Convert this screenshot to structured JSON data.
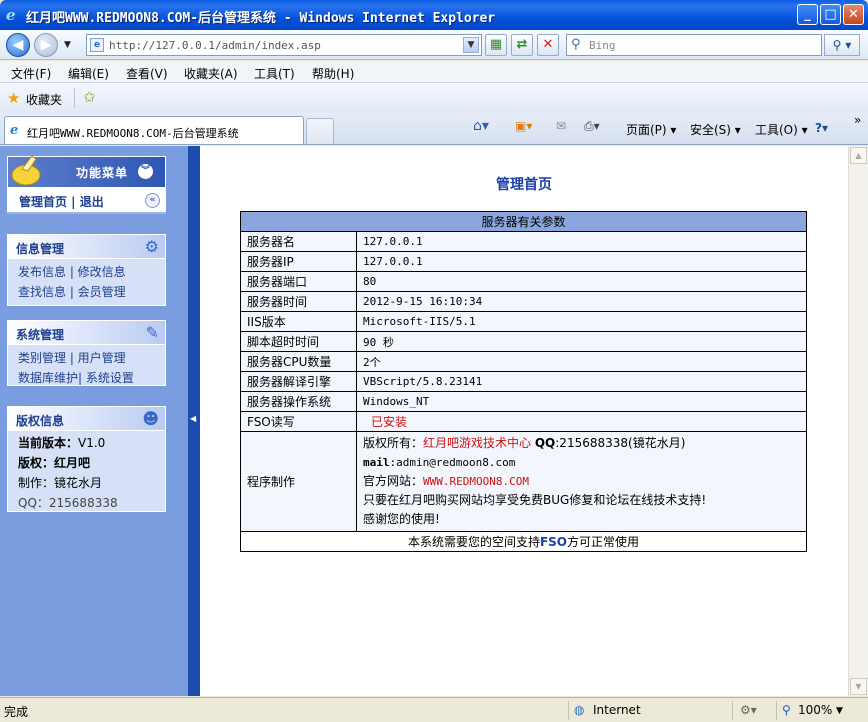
{
  "window": {
    "title": "红月吧WWW.REDMOON8.COM-后台管理系统 - Windows Internet Explorer",
    "minimize": "_",
    "maximize": "□",
    "close": "✕"
  },
  "address_bar": {
    "url": "http://127.0.0.1/admin/index.asp",
    "search_placeholder": "Bing"
  },
  "menu": [
    "文件(F)",
    "编辑(E)",
    "查看(V)",
    "收藏夹(A)",
    "工具(T)",
    "帮助(H)"
  ],
  "favorites": {
    "label": "收藏夹"
  },
  "tab": {
    "title": "红月吧WWW.REDMOON8.COM-后台管理系统"
  },
  "command_bar": {
    "page": "页面(P)",
    "safety": "安全(S)",
    "tools": "工具(O)",
    "more": "»"
  },
  "sidebar": {
    "menu_title": "功能菜单",
    "home": "管理首页 | 退出",
    "sections": [
      {
        "title": "信息管理",
        "rows": [
          "发布信息 | 修改信息",
          "查找信息 | 会员管理"
        ]
      },
      {
        "title": "系统管理",
        "rows": [
          "类别管理 | 用户管理",
          "数据库维护| 系统设置"
        ]
      }
    ],
    "copyright": {
      "title": "版权信息",
      "version_label": "当前版本：",
      "version": "V1.0",
      "owner": "版权：红月吧",
      "maker": "制作：镜花水月",
      "qq": "QQ：215688338"
    }
  },
  "main": {
    "page_title": "管理首页",
    "table_header": "服务器有关参数",
    "rows": [
      {
        "k": "服务器名",
        "v": "127.0.0.1"
      },
      {
        "k": "服务器IP",
        "v": "127.0.0.1"
      },
      {
        "k": "服务器端口",
        "v": "80"
      },
      {
        "k": "服务器时间",
        "v": "2012-9-15 16:10:34"
      },
      {
        "k": "IIS版本",
        "v": "Microsoft-IIS/5.1"
      },
      {
        "k": "脚本超时时间",
        "v": "90 秒"
      },
      {
        "k": "服务器CPU数量",
        "v": "2个"
      },
      {
        "k": "服务器解译引擎",
        "v": "VBScript/5.8.23141"
      },
      {
        "k": "服务器操作系统",
        "v": "Windows_NT"
      },
      {
        "k": "FSO读写",
        "v": "已安装"
      }
    ],
    "program": {
      "label": "程序制作",
      "copyright_prefix": "版权所有：",
      "copyright_link": "红月吧游戏技术中心",
      "qq_label": "QQ",
      "qq_value": ":215688338(镜花水月)",
      "mail_label": "mail",
      "mail_value": ":admin@redmoon8.com",
      "site_prefix": "官方网站：",
      "site_link": "WWW.REDMOON8.COM",
      "line4": "只要在红月吧购买网站均享受免费BUG修复和论坛在线技术支持!",
      "line5": "感谢您的使用!"
    },
    "footer_prefix": "本系统需要您的空间支持",
    "footer_fso": "FSO",
    "footer_suffix": "方可正常使用"
  },
  "status_bar": {
    "status": "完成",
    "zone": "Internet",
    "zoom": "100%"
  },
  "colors": {
    "accent": "#1d4cae",
    "sidebar": "#7a9de0",
    "link_red": "#d01010"
  }
}
